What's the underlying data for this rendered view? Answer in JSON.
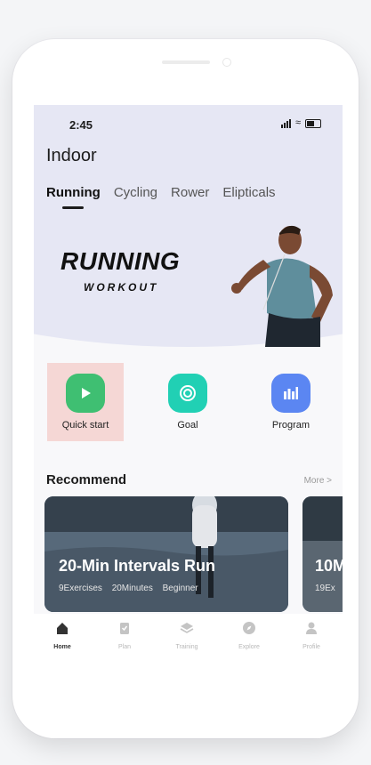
{
  "status": {
    "time": "2:45"
  },
  "header": {
    "title": "Indoor"
  },
  "tabs": [
    {
      "label": "Running",
      "active": true
    },
    {
      "label": "Cycling",
      "active": false
    },
    {
      "label": "Rower",
      "active": false
    },
    {
      "label": "Elipticals",
      "active": false
    }
  ],
  "banner": {
    "title": "RUNNING",
    "subtitle": "WORKOUT"
  },
  "actions": [
    {
      "label": "Quick start",
      "icon": "play-icon",
      "color": "#3fbf72",
      "highlighted": true
    },
    {
      "label": "Goal",
      "icon": "target-icon",
      "color": "#21d0b4"
    },
    {
      "label": "Program",
      "icon": "chart-icon",
      "color": "#5b86f2"
    }
  ],
  "recommend": {
    "title": "Recommend",
    "more": "More >",
    "cards": [
      {
        "title": "20-Min Intervals Run",
        "exercises": "9Exercises",
        "duration": "20Minutes",
        "level": "Beginner"
      },
      {
        "title": "10M",
        "exercises": "19Ex"
      }
    ]
  },
  "bottom_nav": [
    {
      "label": "Home",
      "icon": "home-icon",
      "active": true
    },
    {
      "label": "Plan",
      "icon": "clipboard-icon"
    },
    {
      "label": "Training",
      "icon": "layers-icon"
    },
    {
      "label": "Explore",
      "icon": "compass-icon"
    },
    {
      "label": "Profile",
      "icon": "person-icon"
    }
  ]
}
